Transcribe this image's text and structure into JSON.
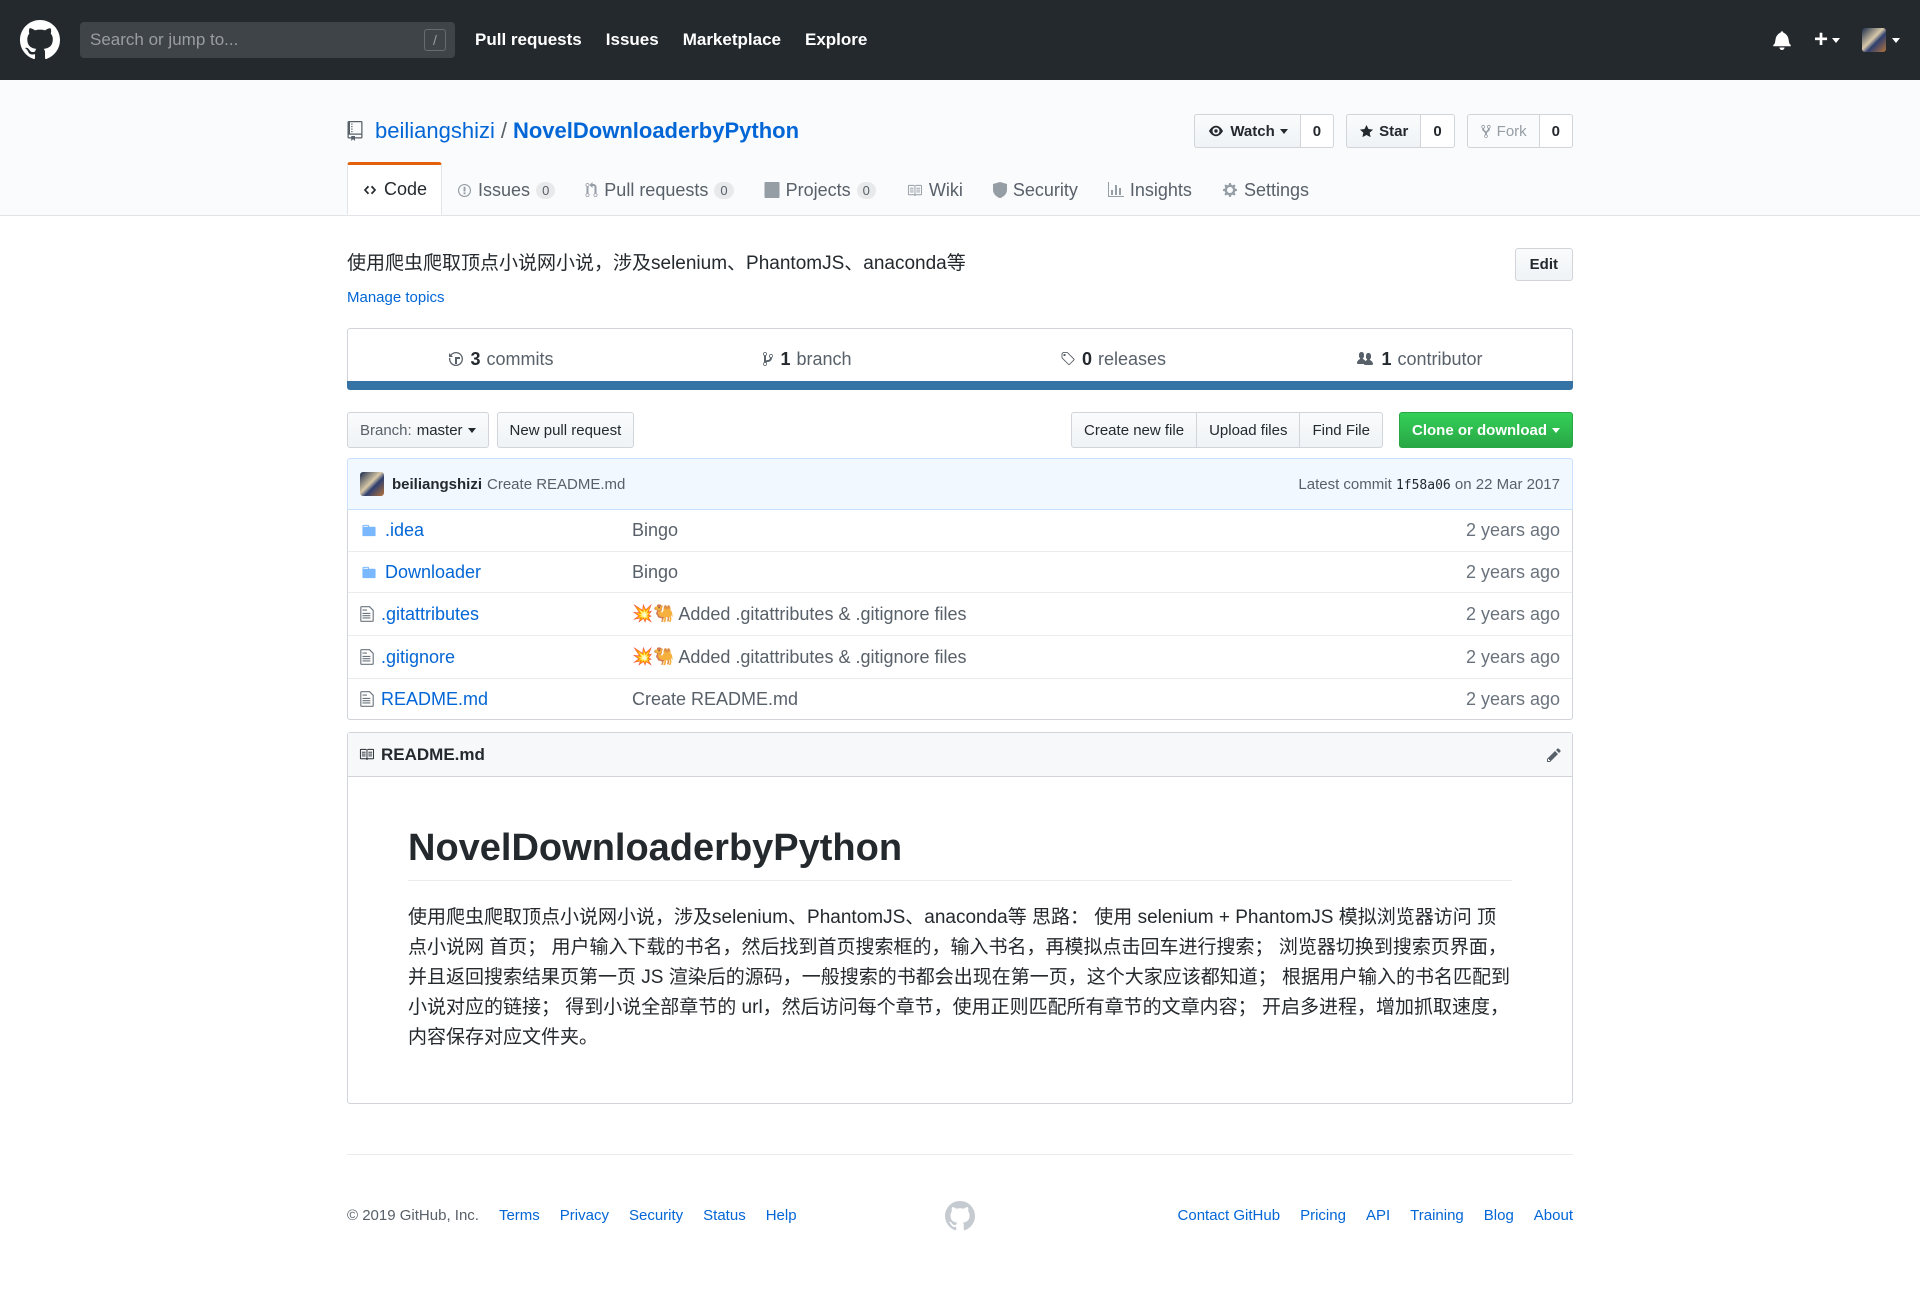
{
  "header": {
    "search_placeholder": "Search or jump to...",
    "search_shortcut": "/",
    "nav": [
      "Pull requests",
      "Issues",
      "Marketplace",
      "Explore"
    ],
    "plus": "+"
  },
  "repo": {
    "owner": "beiliangshizi",
    "separator": "/",
    "name": "NovelDownloaderbyPython",
    "watch_label": "Watch",
    "watch_count": "0",
    "star_label": "Star",
    "star_count": "0",
    "fork_label": "Fork",
    "fork_count": "0"
  },
  "tabs": [
    {
      "label": "Code",
      "counter": ""
    },
    {
      "label": "Issues",
      "counter": "0"
    },
    {
      "label": "Pull requests",
      "counter": "0"
    },
    {
      "label": "Projects",
      "counter": "0"
    },
    {
      "label": "Wiki",
      "counter": ""
    },
    {
      "label": "Security",
      "counter": ""
    },
    {
      "label": "Insights",
      "counter": ""
    },
    {
      "label": "Settings",
      "counter": ""
    }
  ],
  "description": {
    "text": "使用爬虫爬取顶点小说网小说，涉及selenium、PhantomJS、anaconda等",
    "edit_label": "Edit",
    "topics_link": "Manage topics"
  },
  "summary": {
    "commits_num": "3",
    "commits_label": "commits",
    "branch_num": "1",
    "branch_label": "branch",
    "releases_num": "0",
    "releases_label": "releases",
    "contributor_num": "1",
    "contributor_label": "contributor",
    "language_color": "#3572a5"
  },
  "filenav": {
    "branch_prefix": "Branch:",
    "branch_name": "master",
    "new_pr": "New pull request",
    "create_file": "Create new file",
    "upload_files": "Upload files",
    "find_file": "Find File",
    "clone": "Clone or download"
  },
  "commit": {
    "author": "beiliangshizi",
    "message": "Create README.md",
    "latest_label": "Latest commit",
    "sha": "1f58a06",
    "on_label": "on",
    "date": "22 Mar 2017"
  },
  "files": [
    {
      "name": ".idea",
      "type": "folder",
      "message": "Bingo",
      "emoji": "",
      "age": "2 years ago"
    },
    {
      "name": "Downloader",
      "type": "folder",
      "message": "Bingo",
      "emoji": "",
      "age": "2 years ago"
    },
    {
      "name": ".gitattributes",
      "type": "file",
      "message": "Added .gitattributes & .gitignore files",
      "emoji": "💥🐫",
      "age": "2 years ago"
    },
    {
      "name": ".gitignore",
      "type": "file",
      "message": "Added .gitattributes & .gitignore files",
      "emoji": "💥🐫",
      "age": "2 years ago"
    },
    {
      "name": "README.md",
      "type": "file",
      "message": "Create README.md",
      "emoji": "",
      "age": "2 years ago"
    }
  ],
  "readme": {
    "filename": "README.md",
    "heading": "NovelDownloaderbyPython",
    "body": "使用爬虫爬取顶点小说网小说，涉及selenium、PhantomJS、anaconda等 思路： 使用 selenium + PhantomJS 模拟浏览器访问 顶点小说网 首页； 用户输入下载的书名，然后找到首页搜索框的，输入书名，再模拟点击回车进行搜索； 浏览器切换到搜索页界面，并且返回搜索结果页第一页 JS 渲染后的源码，一般搜索的书都会出现在第一页，这个大家应该都知道； 根据用户输入的书名匹配到小说对应的链接； 得到小说全部章节的 url，然后访问每个章节，使用正则匹配所有章节的文章内容； 开启多进程，增加抓取速度，内容保存对应文件夹。"
  },
  "footer": {
    "copyright": "© 2019 GitHub, Inc.",
    "left_links": [
      "Terms",
      "Privacy",
      "Security",
      "Status",
      "Help"
    ],
    "right_links": [
      "Contact GitHub",
      "Pricing",
      "API",
      "Training",
      "Blog",
      "About"
    ]
  }
}
